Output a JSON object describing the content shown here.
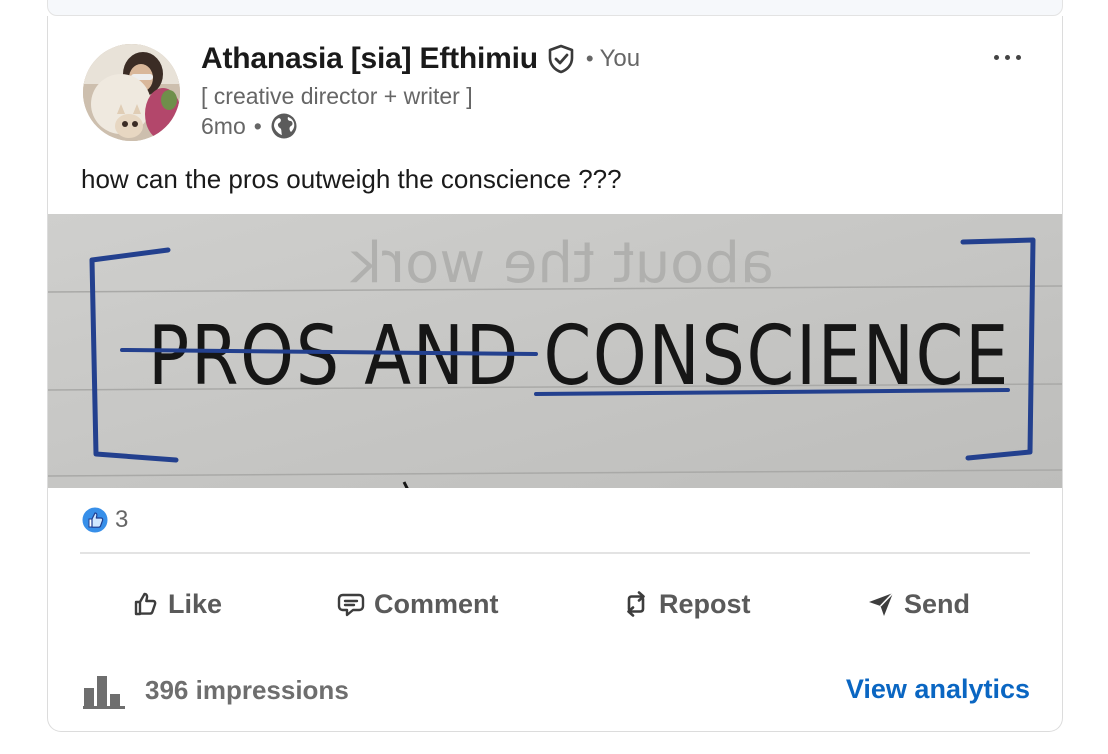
{
  "post": {
    "author": {
      "name": "Athanasia [sia] Efthimiu",
      "you_label": "You",
      "separator": "•",
      "headline": "[ creative director + writer ]",
      "time": "6mo",
      "time_separator": "•",
      "verified_icon": "verified-shield-icon",
      "visibility_icon": "globe-icon"
    },
    "menu_icon": "more-horizontal-icon",
    "text": "how can the pros outweigh the conscience ???",
    "image": {
      "handwriting_main": "PROS AND CONSCIENCE",
      "handwriting_faint": "about the work"
    },
    "reactions": {
      "icon": "like-reaction-icon",
      "count": "3"
    },
    "actions": [
      {
        "label": "Like",
        "icon": "thumbs-up-icon"
      },
      {
        "label": "Comment",
        "icon": "comment-icon"
      },
      {
        "label": "Repost",
        "icon": "repost-icon"
      },
      {
        "label": "Send",
        "icon": "send-icon"
      }
    ],
    "footer": {
      "impressions": "396 impressions",
      "analytics_link": "View analytics",
      "analytics_icon": "bar-chart-icon"
    }
  },
  "colors": {
    "link": "#0a66c2",
    "reaction_blue": "#378fe9",
    "ink_blue": "#1f3d8f",
    "muted": "#666666"
  }
}
